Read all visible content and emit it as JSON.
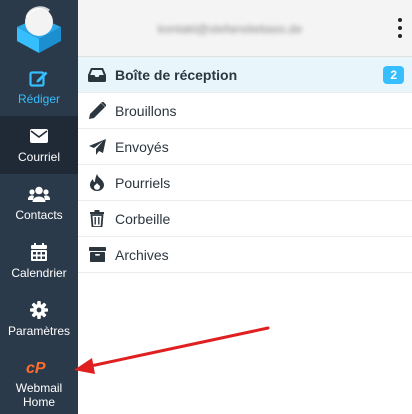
{
  "header": {
    "account_email": "kontakt@stefanstiebass.de"
  },
  "sidebar": {
    "items": [
      {
        "label": "Rédiger",
        "icon": "compose-icon"
      },
      {
        "label": "Courriel",
        "icon": "envelope-icon"
      },
      {
        "label": "Contacts",
        "icon": "users-icon"
      },
      {
        "label": "Calendrier",
        "icon": "calendar-icon"
      },
      {
        "label": "Paramètres",
        "icon": "gear-icon"
      },
      {
        "label_line1": "Webmail",
        "label_line2": "Home",
        "icon": "cpanel-icon"
      }
    ]
  },
  "folders": [
    {
      "label": "Boîte de réception",
      "icon": "inbox-icon",
      "unread": "2"
    },
    {
      "label": "Brouillons",
      "icon": "pencil-icon"
    },
    {
      "label": "Envoyés",
      "icon": "paper-plane-icon"
    },
    {
      "label": "Pourriels",
      "icon": "fire-icon"
    },
    {
      "label": "Corbeille",
      "icon": "trash-icon"
    },
    {
      "label": "Archives",
      "icon": "archive-box-icon"
    }
  ],
  "colors": {
    "sidebar": "#2b3a4a",
    "sidebar_active": "#1f2a36",
    "accent": "#37beff",
    "selected_folder_bg": "#e8f6fc",
    "arrow": "#e02020",
    "cpanel_orange": "#ff6c2c"
  }
}
